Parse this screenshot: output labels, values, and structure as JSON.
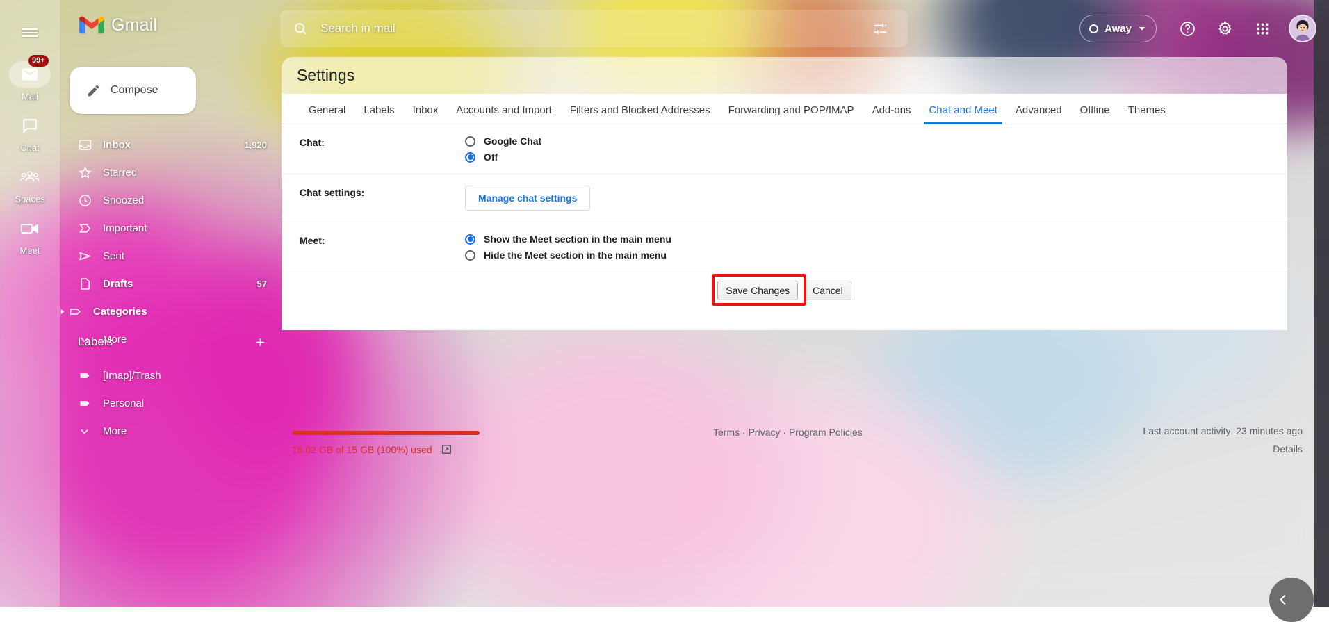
{
  "app": {
    "brand": "Gmail",
    "menu_icon": "hamburger-icon"
  },
  "rail": {
    "items": [
      {
        "label": "Mail",
        "icon": "envelope-icon",
        "badge": "99+",
        "active": true
      },
      {
        "label": "Chat",
        "icon": "chat-bubble-icon",
        "badge": "",
        "active": false
      },
      {
        "label": "Spaces",
        "icon": "people-icon",
        "badge": "",
        "active": false
      },
      {
        "label": "Meet",
        "icon": "video-camera-icon",
        "badge": "",
        "active": false
      }
    ]
  },
  "search": {
    "placeholder": "Search in mail",
    "value": "",
    "icon": "search-icon",
    "filter_icon": "tune-filter-icon"
  },
  "topbar": {
    "status_label": "Away",
    "status_icon": "away-circle-icon",
    "status_caret": "chevron-down-icon",
    "help_icon": "help-circle-icon",
    "settings_icon": "gear-icon",
    "apps_icon": "apps-grid-icon",
    "avatar_name": "avatar"
  },
  "compose": {
    "label": "Compose",
    "icon": "pencil-icon"
  },
  "nav": {
    "items": [
      {
        "label": "Inbox",
        "icon": "inbox-icon",
        "count": "1,920",
        "bold": true,
        "caret": ""
      },
      {
        "label": "Starred",
        "icon": "star-icon",
        "count": "",
        "bold": false,
        "caret": ""
      },
      {
        "label": "Snoozed",
        "icon": "clock-icon",
        "count": "",
        "bold": false,
        "caret": ""
      },
      {
        "label": "Important",
        "icon": "label-important-icon",
        "count": "",
        "bold": false,
        "caret": ""
      },
      {
        "label": "Sent",
        "icon": "send-icon",
        "count": "",
        "bold": false,
        "caret": ""
      },
      {
        "label": "Drafts",
        "icon": "draft-icon",
        "count": "57",
        "bold": true,
        "caret": ""
      },
      {
        "label": "Categories",
        "icon": "tag-icon",
        "count": "",
        "bold": true,
        "caret": "chevron-right-icon"
      },
      {
        "label": "More",
        "icon": "chevron-down-icon",
        "count": "",
        "bold": false,
        "caret": ""
      }
    ]
  },
  "labels": {
    "title": "Labels",
    "add_icon": "plus-icon",
    "items": [
      {
        "label": "[Imap]/Trash",
        "icon": "label-icon"
      },
      {
        "label": "Personal",
        "icon": "label-icon"
      },
      {
        "label": "More",
        "icon": "chevron-down-icon"
      }
    ]
  },
  "settings": {
    "title": "Settings",
    "tabs": [
      {
        "label": "General",
        "active": false
      },
      {
        "label": "Labels",
        "active": false
      },
      {
        "label": "Inbox",
        "active": false
      },
      {
        "label": "Accounts and Import",
        "active": false
      },
      {
        "label": "Filters and Blocked Addresses",
        "active": false
      },
      {
        "label": "Forwarding and POP/IMAP",
        "active": false
      },
      {
        "label": "Add-ons",
        "active": false
      },
      {
        "label": "Chat and Meet",
        "active": true
      },
      {
        "label": "Advanced",
        "active": false
      },
      {
        "label": "Offline",
        "active": false
      },
      {
        "label": "Themes",
        "active": false
      }
    ],
    "rows": [
      {
        "label": "Chat:",
        "type": "radios",
        "options": [
          {
            "text": "Google Chat",
            "selected": false
          },
          {
            "text": "Off",
            "selected": true
          }
        ]
      },
      {
        "label": "Chat settings:",
        "type": "button",
        "button_label": "Manage chat settings"
      },
      {
        "label": "Meet:",
        "type": "radios",
        "options": [
          {
            "text": "Show the Meet section in the main menu",
            "selected": true
          },
          {
            "text": "Hide the Meet section in the main menu",
            "selected": false
          }
        ]
      }
    ],
    "save_label": "Save Changes",
    "cancel_label": "Cancel",
    "highlight_color": "#ee1111"
  },
  "footer": {
    "storage_text": "15.02 GB of 15 GB (100%) used",
    "storage_percent": 100,
    "storage_color": "#d93025",
    "storage_link_icon": "open-in-new-icon",
    "terms": "Terms",
    "privacy": "Privacy",
    "program_policies": "Program Policies",
    "separator": " · ",
    "activity": "Last account activity: 23 minutes ago",
    "details": "Details",
    "bottom_chevron_icon": "chevron-left-icon"
  }
}
